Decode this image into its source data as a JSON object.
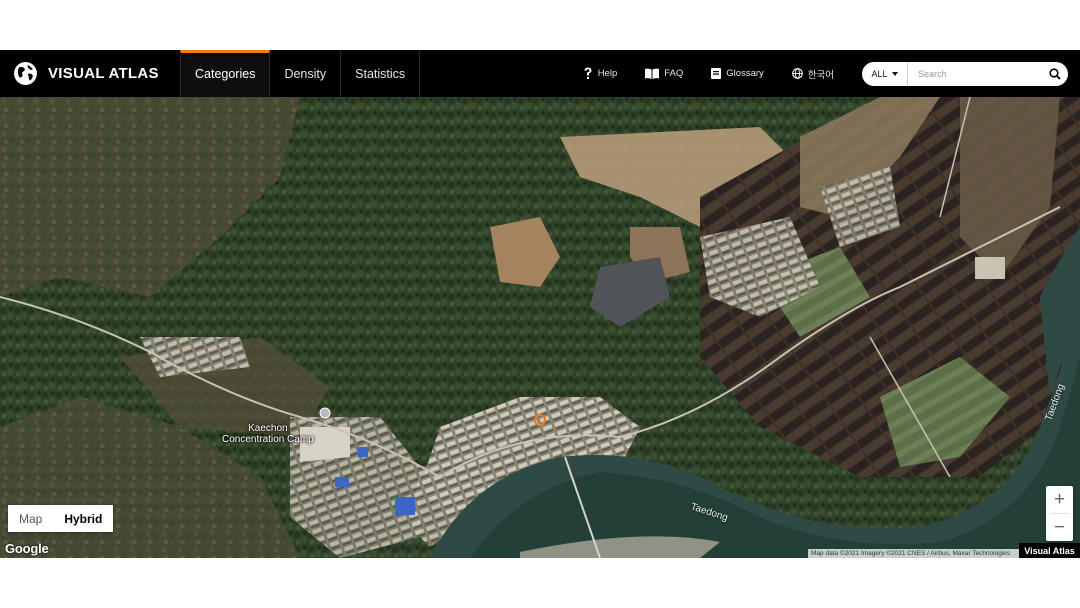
{
  "header": {
    "brand": "VISUAL ATLAS",
    "tabs": [
      {
        "label": "Categories",
        "active": true
      },
      {
        "label": "Density",
        "active": false
      },
      {
        "label": "Statistics",
        "active": false
      }
    ],
    "links": {
      "help": "Help",
      "faq": "FAQ",
      "glossary": "Glossary",
      "language": "한국어"
    },
    "search": {
      "filter_value": "ALL",
      "placeholder": "Search"
    },
    "accent_color": "#f07c1a"
  },
  "map": {
    "type_buttons": {
      "map": "Map",
      "hybrid": "Hybrid"
    },
    "active_type": "Hybrid",
    "place_label": "Kaechon\nConcentration Camp",
    "river_labels": [
      "Taedong",
      "Taedong"
    ],
    "zoom_in": "+",
    "zoom_out": "−",
    "google_logo": "Google",
    "attribution": "Map data ©2021 Imagery ©2021 CNES / Airbus, Maxar Technologies",
    "watermark": "Visual Atlas"
  }
}
